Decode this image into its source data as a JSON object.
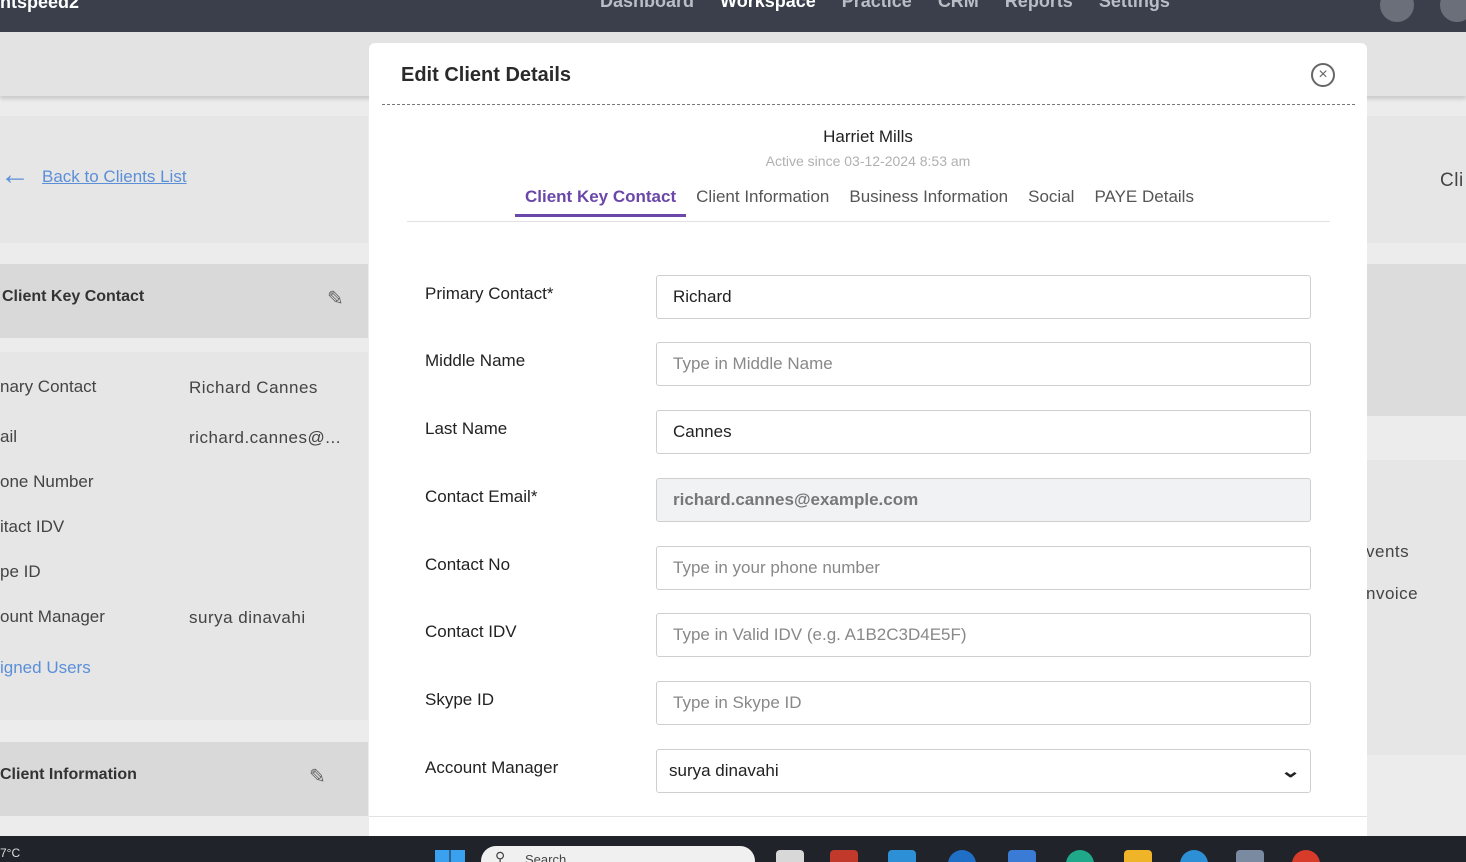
{
  "topbar": {
    "brand": "ntspeed2",
    "nav": [
      "Dashboard",
      "Workspace",
      "Practice",
      "CRM",
      "Reports",
      "Settings"
    ],
    "active_nav": "Workspace"
  },
  "left": {
    "back_link": "Back to Clients List",
    "section1_title": "Client Key Contact",
    "fields": [
      {
        "label": "nary Contact",
        "value": "Richard Cannes"
      },
      {
        "label": "ail",
        "value": "richard.cannes@..."
      },
      {
        "label": "one Number",
        "value": ""
      },
      {
        "label": "itact IDV",
        "value": ""
      },
      {
        "label": "pe ID",
        "value": ""
      },
      {
        "label": "ount Manager",
        "value": "surya dinavahi"
      }
    ],
    "assigned_link": "igned Users",
    "section2_title": "Client Information"
  },
  "right": {
    "cut_title": "Cli",
    "item1": "vents",
    "item2": "nvoice"
  },
  "modal": {
    "title": "Edit Client Details",
    "client_name": "Harriet Mills",
    "active_since": "Active since 03-12-2024 8:53 am",
    "tabs": [
      "Client Key Contact",
      "Client Information",
      "Business Information",
      "Social",
      "PAYE Details"
    ],
    "active_tab": "Client Key Contact",
    "form": {
      "primary_contact": {
        "label": "Primary Contact*",
        "value": "Richard",
        "placeholder": ""
      },
      "middle_name": {
        "label": "Middle Name",
        "value": "",
        "placeholder": "Type in Middle Name"
      },
      "last_name": {
        "label": "Last Name",
        "value": "Cannes",
        "placeholder": ""
      },
      "contact_email": {
        "label": "Contact Email*",
        "value": "richard.cannes@example.com",
        "placeholder": ""
      },
      "contact_no": {
        "label": "Contact No",
        "value": "",
        "placeholder": "Type in your phone number"
      },
      "contact_idv": {
        "label": "Contact IDV",
        "value": "",
        "placeholder": "Type in Valid IDV (e.g. A1B2C3D4E5F)"
      },
      "skype_id": {
        "label": "Skype ID",
        "value": "",
        "placeholder": "Type in Skype ID"
      },
      "account_manager": {
        "label": "Account Manager",
        "value": "surya dinavahi"
      }
    }
  },
  "taskbar": {
    "temperature": "7°C",
    "search_text": "Search"
  },
  "colors": {
    "accent": "#6a47a8",
    "link": "#5b8fd8",
    "topbar": "#3a3f4b"
  }
}
